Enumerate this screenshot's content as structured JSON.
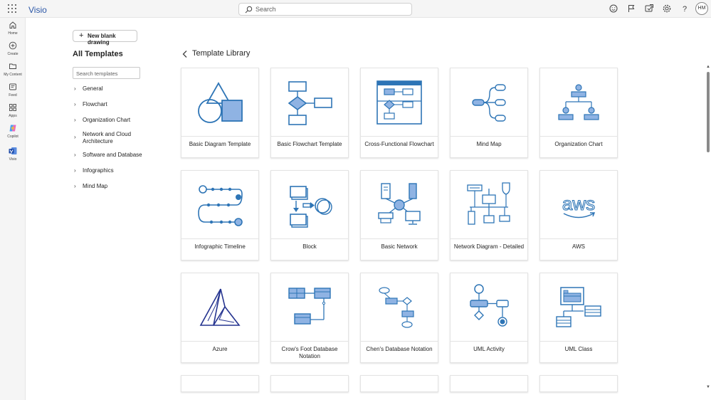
{
  "app": {
    "name": "Visio"
  },
  "header": {
    "search_placeholder": "Search",
    "avatar_initials": "HM"
  },
  "rail": {
    "items": [
      {
        "label": "Home",
        "icon": "home-icon"
      },
      {
        "label": "Create",
        "icon": "plus-circle-icon"
      },
      {
        "label": "My Content",
        "icon": "folder-icon"
      },
      {
        "label": "Feed",
        "icon": "feed-icon"
      },
      {
        "label": "Apps",
        "icon": "apps-icon"
      },
      {
        "label": "Copilot",
        "icon": "copilot-icon"
      },
      {
        "label": "Visio",
        "icon": "visio-icon"
      }
    ]
  },
  "panel": {
    "new_drawing_label": "New blank drawing",
    "title": "All Templates",
    "search_placeholder": "Search templates",
    "categories": [
      "General",
      "Flowchart",
      "Organization Chart",
      "Network and Cloud Architecture",
      "Software and Database",
      "Infographics",
      "Mind Map"
    ]
  },
  "library": {
    "title": "Template Library",
    "templates": [
      "Basic Diagram Template",
      "Basic Flowchart Template",
      "Cross-Functional Flowchart",
      "Mind Map",
      "Organization Chart",
      "Infographic Timeline",
      "Block",
      "Basic Network",
      "Network Diagram - Detailed",
      "AWS",
      "Azure",
      "Crow's Foot Database Notation",
      "Chen's Database Notation",
      "UML Activity",
      "UML Class"
    ]
  },
  "colors": {
    "accent": "#2e75b6",
    "fill": "#8fb3e3",
    "brand": "#2b57a7"
  }
}
